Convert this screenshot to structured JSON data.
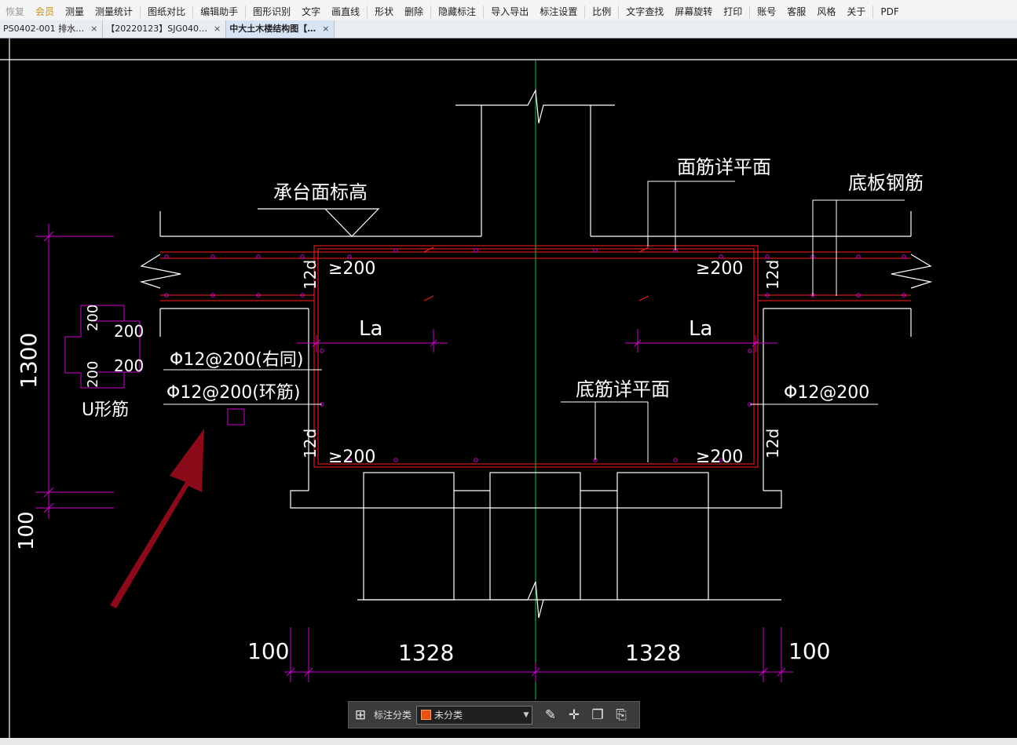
{
  "toolbar": {
    "items": [
      "恢复",
      "会员",
      "测量",
      "测量统计",
      "图纸对比",
      "编辑助手",
      "图形识别",
      "文字",
      "画直线",
      "形状",
      "删除",
      "隐藏标注",
      "导入导出",
      "标注设置",
      "比例",
      "文字查找",
      "屏幕旋转",
      "打印",
      "账号",
      "客服",
      "风格",
      "关于",
      "PDF"
    ]
  },
  "tabs": [
    {
      "label": "PS0402-001  排水…",
      "close": "×"
    },
    {
      "label": "【20220123】SJG040…",
      "close": "×"
    },
    {
      "label": "中大土木楼结构图【…",
      "close": "×"
    }
  ],
  "drawing": {
    "labels": {
      "cap_top_elev": "承台面标高",
      "top_bar_plan": "面筋详平面",
      "slab_bar": "底板钢筋",
      "bottom_bar_plan": "底筋详平面",
      "u_bar": "U形筋",
      "phi_right_same": "Φ12@200(右同)",
      "phi_hoop": "Φ12@200(环筋)",
      "phi_right": "Φ12@200",
      "ge200": "≥200",
      "la": "La",
      "d12": "12d"
    },
    "dims": {
      "h1300": "1300",
      "h100": "100",
      "u200": "200",
      "b100": "100",
      "b1328": "1328"
    },
    "colors": {
      "background": "#000000",
      "line": "#ffffff",
      "rebar": "#ff2020",
      "dimension": "#d000d0",
      "axis": "#1fbf3f",
      "arrow": "#8a0a1a"
    }
  },
  "annotation": {
    "label": "标注分类",
    "selected": "未分类",
    "swatch_color": "#e8520e"
  }
}
